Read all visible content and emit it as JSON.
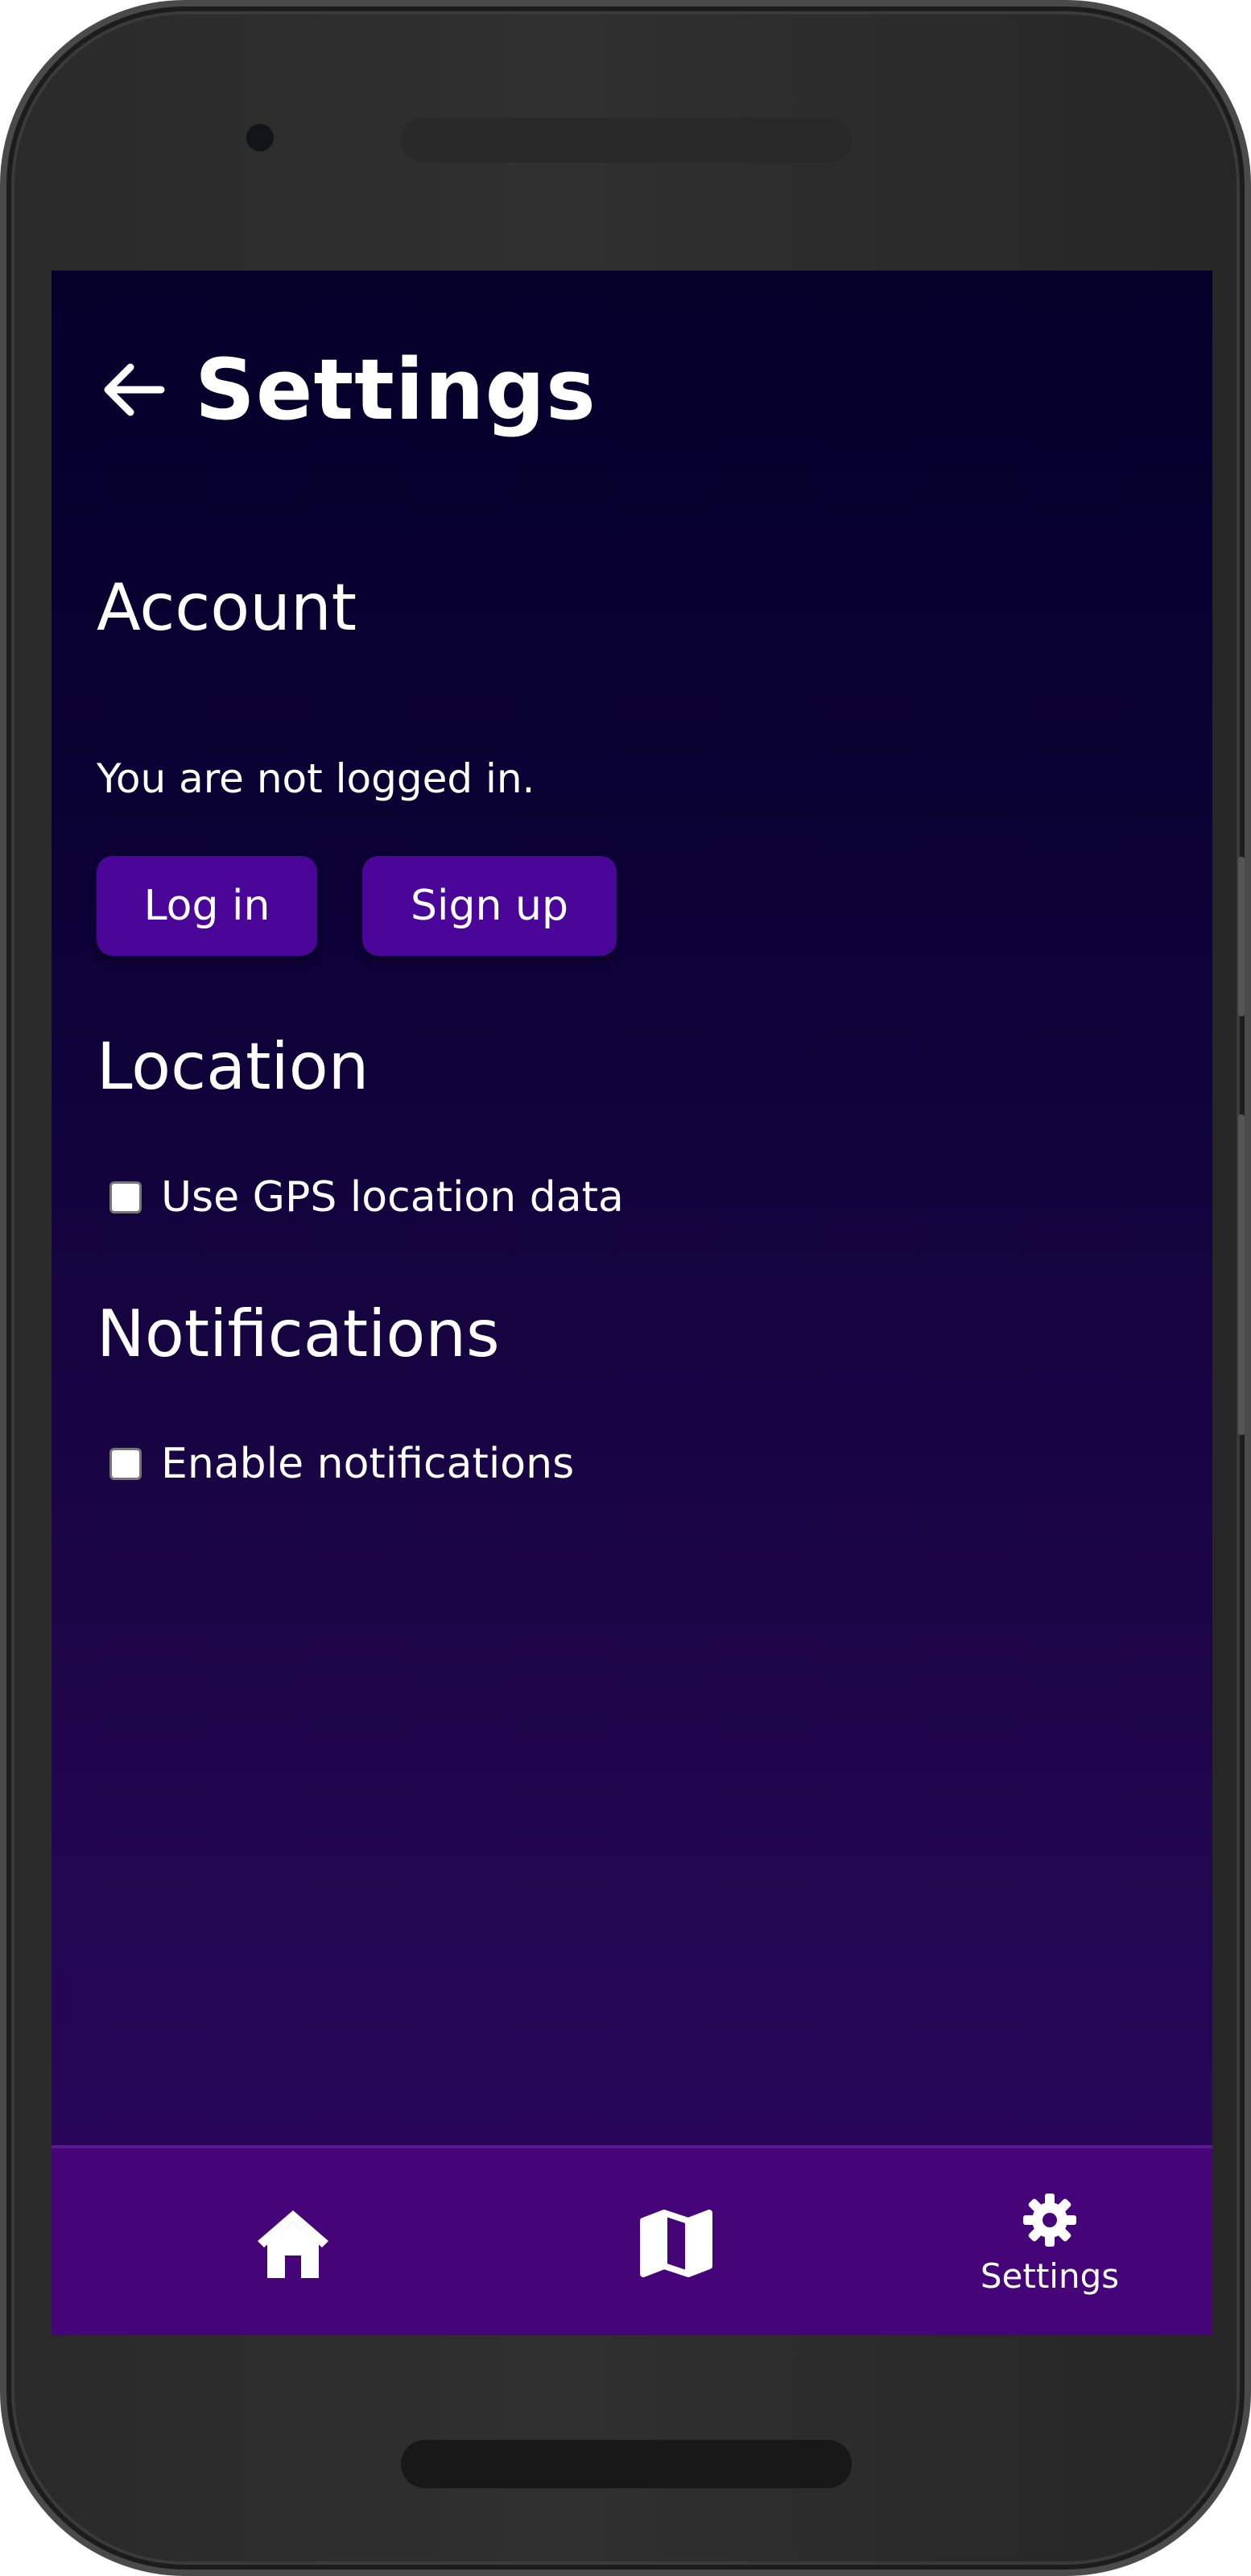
{
  "header": {
    "title": "Settings",
    "back_icon": "arrow-left-icon"
  },
  "account": {
    "heading": "Account",
    "status": "You are not logged in.",
    "login_label": "Log in",
    "signup_label": "Sign up"
  },
  "location": {
    "heading": "Location",
    "gps_label": "Use GPS location data",
    "gps_checked": false
  },
  "notifications": {
    "heading": "Notifications",
    "enable_label": "Enable notifications",
    "enable_checked": false
  },
  "bottom_nav": {
    "items": [
      {
        "icon": "home-icon",
        "label": ""
      },
      {
        "icon": "map-icon",
        "label": ""
      },
      {
        "icon": "gear-icon",
        "label": "Settings"
      }
    ]
  },
  "colors": {
    "button_bg": "#4a0599",
    "nav_bg": "#460479",
    "screen_top": "#04002a",
    "screen_bottom": "#2b0760"
  }
}
